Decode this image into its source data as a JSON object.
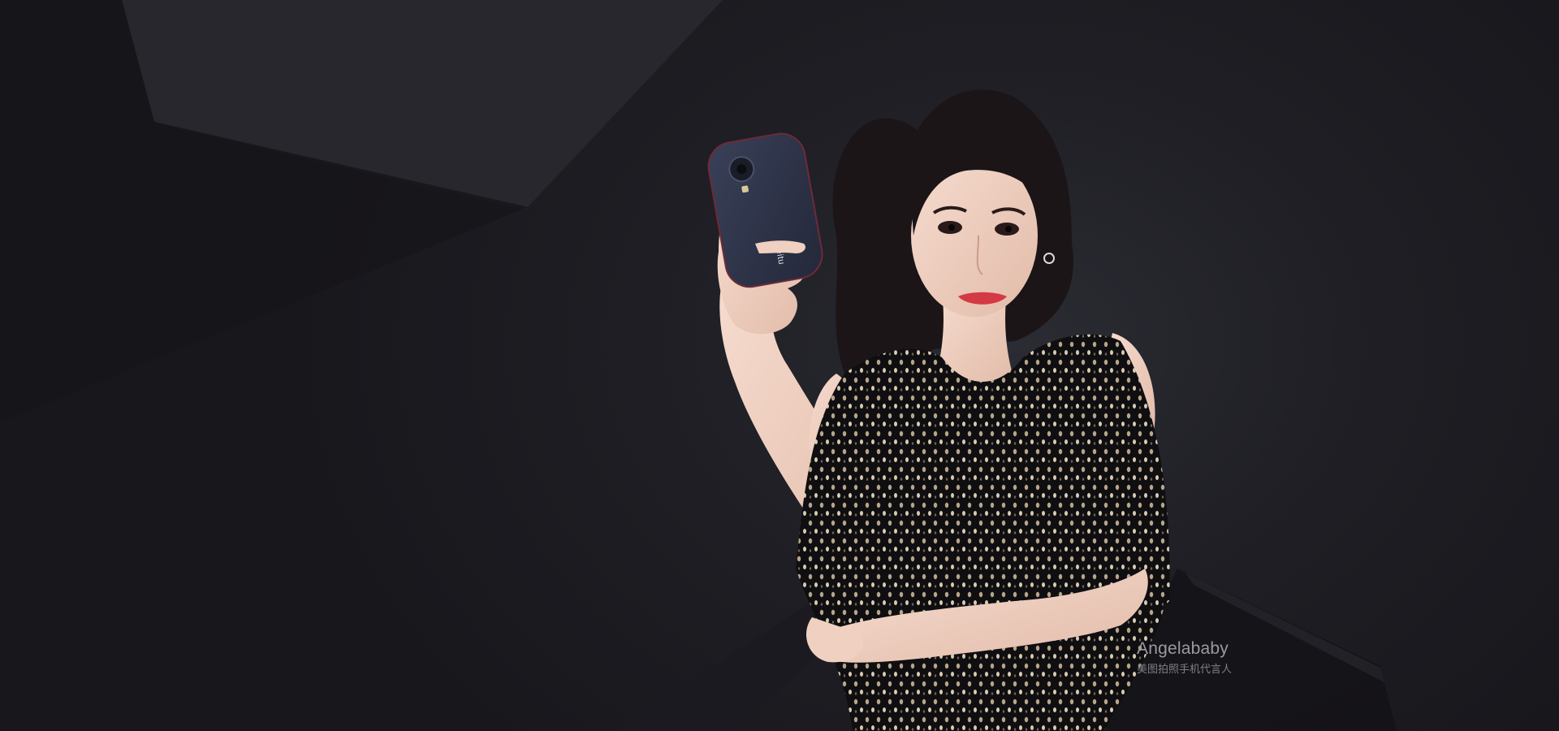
{
  "hero": {
    "person_name": "Angelababy",
    "person_tagline": "美图拍照手机代言人",
    "phone_brand": "meitu"
  },
  "colors": {
    "background": "#17161b",
    "plane_light": "#26262c",
    "caption": "#9a9aa1",
    "dress": "#0e0d10",
    "sequin": "#c9b89a",
    "skin": "#f2d5c6",
    "hair": "#1a1416",
    "lips": "#d43a44",
    "phone_body": "#2f3448"
  },
  "icons": [
    "camera-lens-icon",
    "flash-icon"
  ]
}
